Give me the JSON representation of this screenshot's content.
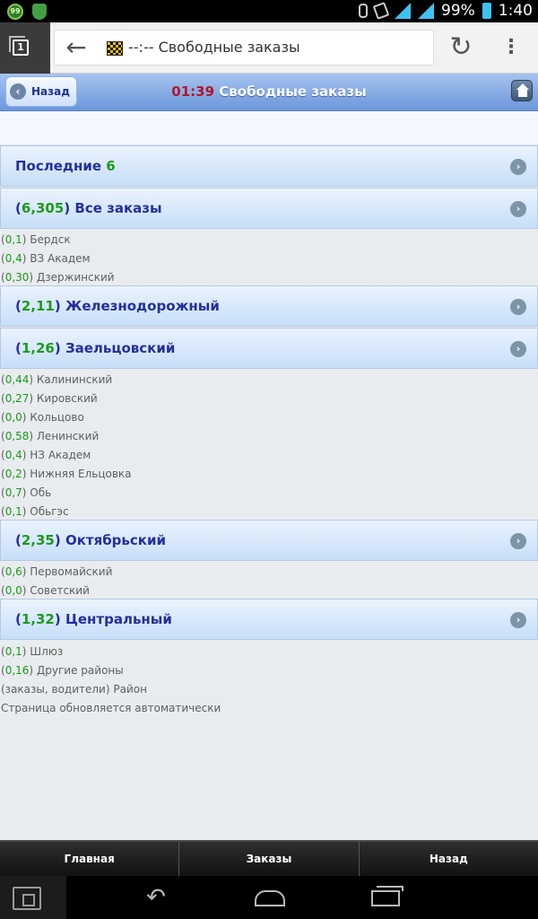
{
  "status_bar": {
    "battery_percent": "99%",
    "time": "1:40",
    "badge_text": "99",
    "network_label": "H"
  },
  "browser": {
    "tab_count": "1",
    "url_title": "--:-- Свободные заказы"
  },
  "header": {
    "back_label": "Назад",
    "time": "01:39",
    "title": "Свободные заказы"
  },
  "sections": [
    {
      "prefix": "Последние ",
      "num": "6",
      "suffix": ""
    },
    {
      "prefix": "(",
      "num": "6,305",
      "suffix": ") Все заказы"
    },
    {
      "prefix": "(",
      "num": "2,11",
      "suffix": ") Железнодорожный"
    },
    {
      "prefix": "(",
      "num": "1,26",
      "suffix": ") Заельцовский"
    },
    {
      "prefix": "(",
      "num": "2,35",
      "suffix": ") Октябрьский"
    },
    {
      "prefix": "(",
      "num": "1,32",
      "suffix": ") Центральный"
    }
  ],
  "rows": [
    {
      "count": "0,1",
      "name": "Бердск"
    },
    {
      "count": "0,4",
      "name": "ВЗ Академ"
    },
    {
      "count": "0,30",
      "name": "Дзержинский"
    },
    {
      "count": "0,44",
      "name": "Калининский"
    },
    {
      "count": "0,27",
      "name": "Кировский"
    },
    {
      "count": "0,0",
      "name": "Кольцово"
    },
    {
      "count": "0,58",
      "name": "Ленинский"
    },
    {
      "count": "0,4",
      "name": "НЗ Академ"
    },
    {
      "count": "0,2",
      "name": "Нижняя Ельцовка"
    },
    {
      "count": "0,7",
      "name": "Обь"
    },
    {
      "count": "0,1",
      "name": "Обьгэс"
    },
    {
      "count": "0,6",
      "name": "Первомайский"
    },
    {
      "count": "0,0",
      "name": "Советский"
    },
    {
      "count": "0,1",
      "name": "Шлюз"
    },
    {
      "count": "0,16",
      "name": "Другие районы"
    }
  ],
  "footer_notes": {
    "legend": "(заказы, водители) Район",
    "auto_refresh": "Страница обновляется автоматически"
  },
  "bottom_tabs": {
    "home": "Главная",
    "orders": "Заказы",
    "back": "Назад"
  },
  "colors": {
    "header_blue": "#6b97dc",
    "title_blue": "#24309a",
    "count_green": "#1e9a1e",
    "time_red": "#b6152b"
  }
}
